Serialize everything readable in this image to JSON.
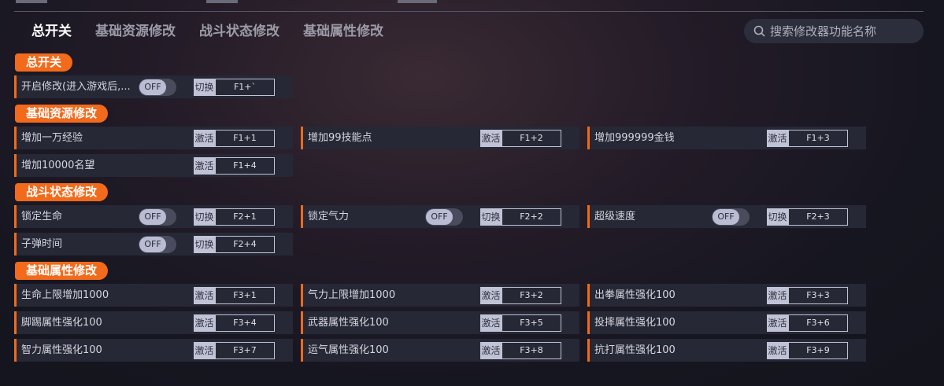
{
  "tabs": [
    {
      "label": "总开关",
      "active": true
    },
    {
      "label": "基础资源修改",
      "active": false
    },
    {
      "label": "战斗状态修改",
      "active": false
    },
    {
      "label": "基础属性修改",
      "active": false
    }
  ],
  "search": {
    "placeholder": "搜索修改器功能名称"
  },
  "sections": {
    "master": {
      "title": "总开关",
      "items": [
        {
          "label": "开启修改(进入游戏后,...",
          "toggle": "OFF",
          "action": "切换",
          "hotkey": "F1+`"
        }
      ]
    },
    "resources": {
      "title": "基础资源修改",
      "items": [
        {
          "label": "增加一万经验",
          "action": "激活",
          "hotkey": "F1+1"
        },
        {
          "label": "增加99技能点",
          "action": "激活",
          "hotkey": "F1+2"
        },
        {
          "label": "增加999999金钱",
          "action": "激活",
          "hotkey": "F1+3"
        },
        {
          "label": "增加10000名望",
          "action": "激活",
          "hotkey": "F1+4"
        }
      ]
    },
    "combat": {
      "title": "战斗状态修改",
      "items": [
        {
          "label": "锁定生命",
          "toggle": "OFF",
          "action": "切换",
          "hotkey": "F2+1"
        },
        {
          "label": "锁定气力",
          "toggle": "OFF",
          "action": "切换",
          "hotkey": "F2+2"
        },
        {
          "label": "超级速度",
          "toggle": "OFF",
          "action": "切换",
          "hotkey": "F2+3"
        },
        {
          "label": "子弹时间",
          "toggle": "OFF",
          "action": "切换",
          "hotkey": "F2+4"
        }
      ]
    },
    "attributes": {
      "title": "基础属性修改",
      "items": [
        {
          "label": "生命上限增加1000",
          "action": "激活",
          "hotkey": "F3+1"
        },
        {
          "label": "气力上限增加1000",
          "action": "激活",
          "hotkey": "F3+2"
        },
        {
          "label": "出拳属性强化100",
          "action": "激活",
          "hotkey": "F3+3"
        },
        {
          "label": "脚踢属性强化100",
          "action": "激活",
          "hotkey": "F3+4"
        },
        {
          "label": "武器属性强化100",
          "action": "激活",
          "hotkey": "F3+5"
        },
        {
          "label": "投摔属性强化100",
          "action": "激活",
          "hotkey": "F3+6"
        },
        {
          "label": "智力属性强化100",
          "action": "激活",
          "hotkey": "F3+7"
        },
        {
          "label": "运气属性强化100",
          "action": "激活",
          "hotkey": "F3+8"
        },
        {
          "label": "抗打属性强化100",
          "action": "激活",
          "hotkey": "F3+9"
        }
      ]
    }
  },
  "colors": {
    "accent": "#f26a1b",
    "row_bg": "#262836",
    "button_bg": "#c0c3d6"
  }
}
